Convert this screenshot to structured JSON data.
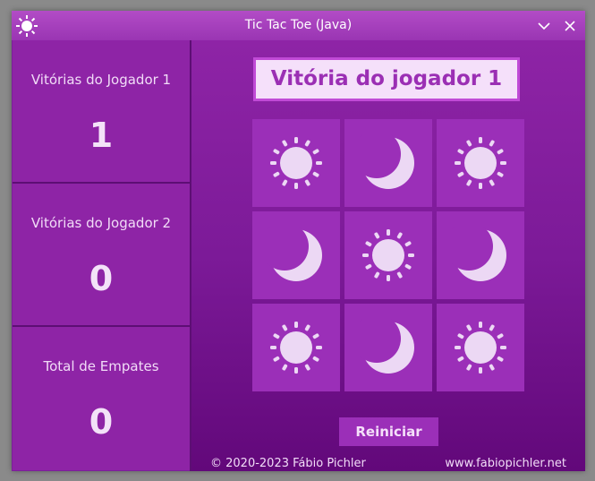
{
  "window": {
    "title": "Tic Tac Toe (Java)"
  },
  "colors": {
    "accent": "#9b2fb8",
    "background": "#7c1f9a",
    "piece": "#ecd8f4",
    "banner_bg": "#f5e0fa"
  },
  "stats": [
    {
      "label": "Vitórias do Jogador 1",
      "value": "1"
    },
    {
      "label": "Vitórias do Jogador 2",
      "value": "0"
    },
    {
      "label": "Total de Empates",
      "value": "0"
    }
  ],
  "banner": {
    "text": "Vitória do jogador 1"
  },
  "board": [
    [
      "sun-icon",
      "moon-icon",
      "sun-icon"
    ],
    [
      "moon-icon",
      "sun-icon",
      "moon-icon"
    ],
    [
      "sun-icon",
      "moon-icon",
      "sun-icon"
    ]
  ],
  "restart_label": "Reiniciar",
  "footer": {
    "copyright": "© 2020-2023 Fábio Pichler",
    "website": "www.fabiopichler.net"
  }
}
